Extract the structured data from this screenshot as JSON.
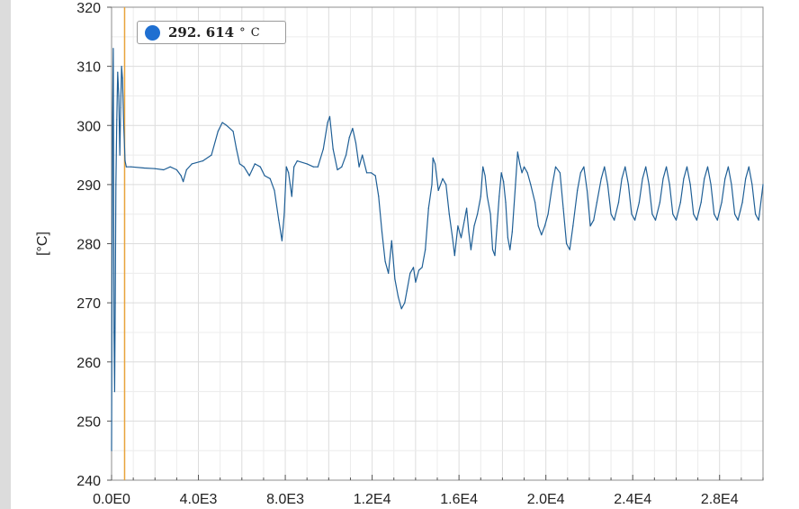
{
  "chart_data": {
    "type": "line",
    "title": "",
    "ylabel": "[°C]",
    "xlabel": "",
    "xlim": [
      0,
      30000
    ],
    "ylim": [
      240,
      320
    ],
    "x_ticks": [
      0,
      4000,
      8000,
      12000,
      16000,
      20000,
      24000,
      28000
    ],
    "x_tick_labels": [
      "0.0E0",
      "4.0E3",
      "8.0E3",
      "1.2E4",
      "1.6E4",
      "2.0E4",
      "2.4E4",
      "2.8E4"
    ],
    "y_ticks": [
      240,
      250,
      260,
      270,
      280,
      290,
      300,
      310,
      320
    ],
    "y_tick_labels": [
      "240",
      "250",
      "260",
      "270",
      "280",
      "290",
      "300",
      "310",
      "320"
    ],
    "grid": true,
    "cursor_x": 600,
    "cursor_color": "#e8a33a",
    "line_color": "#1f5f96",
    "legend": {
      "value": "292. 614",
      "unit": "° C",
      "dot_color": "#1f6fd1",
      "placement": "top-left"
    },
    "series": [
      {
        "points": [
          [
            0,
            245
          ],
          [
            40,
            300
          ],
          [
            80,
            313
          ],
          [
            110,
            265
          ],
          [
            140,
            255
          ],
          [
            170,
            270
          ],
          [
            200,
            290
          ],
          [
            240,
            301
          ],
          [
            280,
            309
          ],
          [
            330,
            305
          ],
          [
            380,
            295
          ],
          [
            420,
            303
          ],
          [
            460,
            310
          ],
          [
            500,
            308
          ],
          [
            560,
            300
          ],
          [
            620,
            294
          ],
          [
            680,
            293
          ],
          [
            900,
            293
          ],
          [
            1500,
            292.8
          ],
          [
            2000,
            292.7
          ],
          [
            2400,
            292.5
          ],
          [
            2700,
            293
          ],
          [
            3000,
            292.5
          ],
          [
            3200,
            291.5
          ],
          [
            3300,
            290.5
          ],
          [
            3450,
            292.5
          ],
          [
            3700,
            293.5
          ],
          [
            4200,
            294
          ],
          [
            4600,
            295
          ],
          [
            4900,
            299
          ],
          [
            5100,
            300.5
          ],
          [
            5300,
            300
          ],
          [
            5600,
            299
          ],
          [
            5750,
            296
          ],
          [
            5900,
            293.5
          ],
          [
            6100,
            293
          ],
          [
            6350,
            291.5
          ],
          [
            6600,
            293.5
          ],
          [
            6850,
            293
          ],
          [
            7050,
            291.5
          ],
          [
            7300,
            291
          ],
          [
            7500,
            289
          ],
          [
            7700,
            284
          ],
          [
            7850,
            280.5
          ],
          [
            7950,
            285
          ],
          [
            8050,
            293
          ],
          [
            8150,
            292
          ],
          [
            8300,
            288
          ],
          [
            8400,
            293
          ],
          [
            8550,
            294
          ],
          [
            9000,
            293.5
          ],
          [
            9300,
            293
          ],
          [
            9500,
            293
          ],
          [
            9750,
            296
          ],
          [
            9950,
            300.5
          ],
          [
            10050,
            301.5
          ],
          [
            10200,
            296
          ],
          [
            10400,
            292.5
          ],
          [
            10600,
            293
          ],
          [
            10800,
            295
          ],
          [
            10950,
            298
          ],
          [
            11100,
            299.5
          ],
          [
            11250,
            297
          ],
          [
            11400,
            293
          ],
          [
            11550,
            295
          ],
          [
            11750,
            292
          ],
          [
            11950,
            292
          ],
          [
            12150,
            291.5
          ],
          [
            12300,
            288
          ],
          [
            12450,
            282
          ],
          [
            12600,
            277
          ],
          [
            12750,
            275
          ],
          [
            12900,
            280.5
          ],
          [
            13050,
            274
          ],
          [
            13200,
            271
          ],
          [
            13350,
            269
          ],
          [
            13500,
            270
          ],
          [
            13600,
            272
          ],
          [
            13750,
            275
          ],
          [
            13900,
            276
          ],
          [
            14000,
            273.5
          ],
          [
            14150,
            275.5
          ],
          [
            14300,
            276
          ],
          [
            14450,
            279
          ],
          [
            14600,
            286
          ],
          [
            14750,
            290
          ],
          [
            14800,
            294.5
          ],
          [
            14900,
            293.5
          ],
          [
            15050,
            289
          ],
          [
            15250,
            291
          ],
          [
            15400,
            290
          ],
          [
            15550,
            285
          ],
          [
            15700,
            281
          ],
          [
            15800,
            278
          ],
          [
            15950,
            283
          ],
          [
            16100,
            281
          ],
          [
            16250,
            284
          ],
          [
            16350,
            286
          ],
          [
            16450,
            282
          ],
          [
            16550,
            279
          ],
          [
            16700,
            283
          ],
          [
            16850,
            285
          ],
          [
            17000,
            288
          ],
          [
            17100,
            293
          ],
          [
            17200,
            291.5
          ],
          [
            17300,
            288
          ],
          [
            17450,
            285
          ],
          [
            17550,
            279
          ],
          [
            17650,
            278
          ],
          [
            17750,
            283
          ],
          [
            17850,
            288
          ],
          [
            17950,
            292
          ],
          [
            18050,
            290.5
          ],
          [
            18150,
            287
          ],
          [
            18250,
            281
          ],
          [
            18350,
            279
          ],
          [
            18450,
            282
          ],
          [
            18600,
            290
          ],
          [
            18700,
            295.5
          ],
          [
            18800,
            293.5
          ],
          [
            18900,
            292
          ],
          [
            19000,
            293
          ],
          [
            19150,
            292
          ],
          [
            19300,
            290
          ],
          [
            19500,
            287
          ],
          [
            19650,
            283
          ],
          [
            19800,
            281.5
          ],
          [
            19950,
            283
          ],
          [
            20100,
            285
          ],
          [
            20300,
            290
          ],
          [
            20450,
            293
          ],
          [
            20650,
            292
          ],
          [
            20800,
            286
          ],
          [
            20950,
            280
          ],
          [
            21100,
            279
          ],
          [
            21250,
            283
          ],
          [
            21450,
            289
          ],
          [
            21600,
            292
          ],
          [
            21750,
            293
          ],
          [
            21900,
            289
          ],
          [
            22050,
            283
          ],
          [
            22200,
            284
          ],
          [
            22350,
            287
          ],
          [
            22550,
            291
          ],
          [
            22700,
            293
          ],
          [
            22850,
            290
          ],
          [
            23000,
            285
          ],
          [
            23150,
            284
          ],
          [
            23350,
            287
          ],
          [
            23500,
            291
          ],
          [
            23650,
            293
          ],
          [
            23800,
            290
          ],
          [
            23950,
            285
          ],
          [
            24100,
            284
          ],
          [
            24300,
            287
          ],
          [
            24450,
            291
          ],
          [
            24600,
            293
          ],
          [
            24750,
            290
          ],
          [
            24900,
            285
          ],
          [
            25050,
            284
          ],
          [
            25250,
            287
          ],
          [
            25400,
            291
          ],
          [
            25550,
            293
          ],
          [
            25700,
            290
          ],
          [
            25850,
            285
          ],
          [
            26000,
            284
          ],
          [
            26200,
            287
          ],
          [
            26350,
            291
          ],
          [
            26500,
            293
          ],
          [
            26650,
            290
          ],
          [
            26800,
            285
          ],
          [
            26950,
            284
          ],
          [
            27150,
            287
          ],
          [
            27300,
            291
          ],
          [
            27450,
            293
          ],
          [
            27600,
            290
          ],
          [
            27750,
            285
          ],
          [
            27900,
            284
          ],
          [
            28100,
            287
          ],
          [
            28250,
            291
          ],
          [
            28400,
            293
          ],
          [
            28550,
            290
          ],
          [
            28700,
            285
          ],
          [
            28850,
            284
          ],
          [
            29050,
            287
          ],
          [
            29200,
            291
          ],
          [
            29350,
            293
          ],
          [
            29500,
            290
          ],
          [
            29650,
            285
          ],
          [
            29800,
            284
          ],
          [
            30000,
            290
          ]
        ]
      }
    ]
  }
}
